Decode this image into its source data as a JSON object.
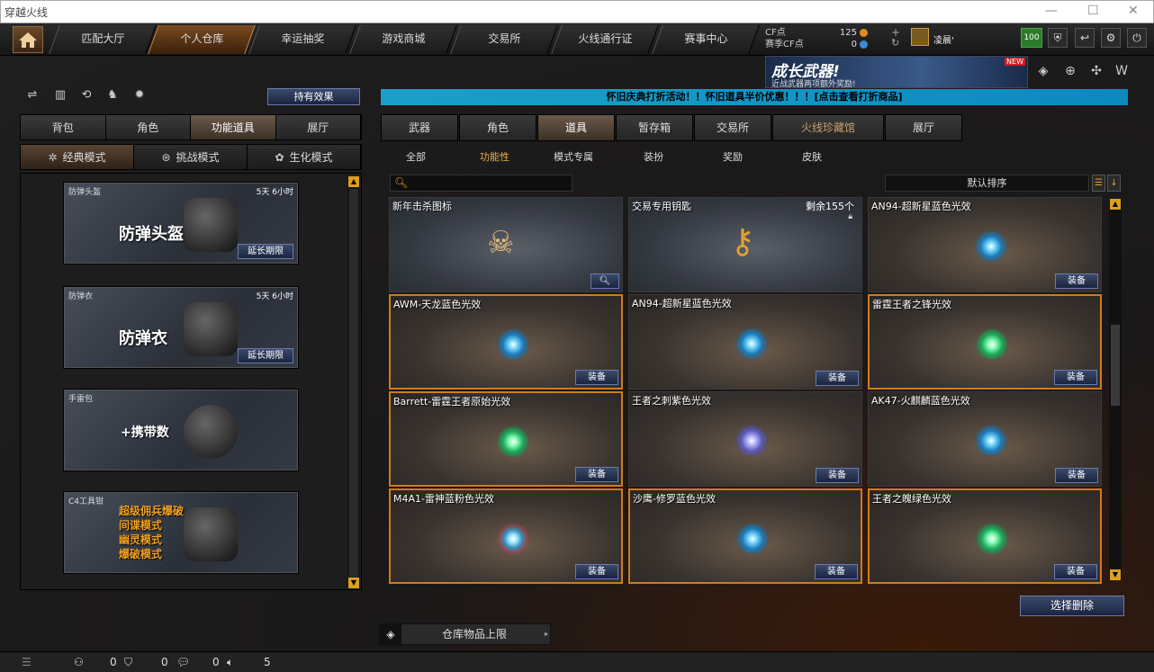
{
  "window": {
    "title": "穿越火线"
  },
  "nav": {
    "tabs": [
      "匹配大厅",
      "个人仓库",
      "幸运抽奖",
      "游戏商城",
      "交易所",
      "火线通行证",
      "赛事中心"
    ],
    "active": 1
  },
  "currency": {
    "cf_label": "CF点",
    "cf_value": "125",
    "match_label": "赛季CF点",
    "match_value": "0"
  },
  "user": {
    "name": "凌晨'",
    "level": "100"
  },
  "promo": {
    "title": "成长武器!",
    "subtitle": "近战武器两项额外奖励!",
    "badge": "NEW"
  },
  "left": {
    "effect_button": "持有效果",
    "tabs": [
      "背包",
      "角色",
      "功能道具",
      "展厅"
    ],
    "active_tab": 2,
    "modes": [
      "经典模式",
      "挑战模式",
      "生化模式"
    ],
    "active_mode": 0,
    "items": [
      {
        "name": "防弹头盔",
        "time": "5天 6小时",
        "big": "防弹头盔",
        "button": "延长期限"
      },
      {
        "name": "防弹衣",
        "time": "5天 6小时",
        "big": "防弹衣",
        "button": "延长期限"
      },
      {
        "name": "手雷包",
        "big": "+携带数"
      },
      {
        "name": "C4工具钳",
        "lines": [
          "超级佣兵爆破",
          "间谍模式",
          "幽灵模式",
          "爆破模式"
        ]
      }
    ]
  },
  "banner": {
    "text": "怀旧庆典打折活动！！怀旧道具半价优惠！！！[点击查看打折商品]"
  },
  "right": {
    "tabs": [
      "武器",
      "角色",
      "道具",
      "暂存箱",
      "交易所",
      "火线珍藏馆",
      "展厅"
    ],
    "active_tab": 2,
    "subcats": [
      "全部",
      "功能性",
      "模式专属",
      "装扮",
      "奖励",
      "皮肤"
    ],
    "active_subcat": 1,
    "search_placeholder": "",
    "sort_label": "默认排序",
    "equip_label": "装备",
    "cards": [
      {
        "name": "新年击杀图标",
        "type": "skull",
        "style": "plain"
      },
      {
        "name": "交易专用钥匙",
        "count": "剩余155个",
        "type": "key",
        "style": "plain"
      },
      {
        "name": "AN94-超新星蓝色光效",
        "orb": "blue",
        "equip": true
      },
      {
        "name": "AWM-天龙蓝色光效",
        "orb": "blue",
        "equip": true,
        "sel": true
      },
      {
        "name": "AN94-超新星蓝色光效",
        "orb": "blue",
        "equip": true
      },
      {
        "name": "雷霆王者之锋光效",
        "orb": "green",
        "equip": true,
        "sel": true
      },
      {
        "name": "Barrett-雷霆王者原始光效",
        "orb": "green",
        "equip": true,
        "sel": true
      },
      {
        "name": "王者之刺紫色光效",
        "orb": "purple",
        "equip": true
      },
      {
        "name": "AK47-火麒麟蓝色光效",
        "orb": "blue",
        "equip": true
      },
      {
        "name": "M4A1-雷神蓝粉色光效",
        "orb": "pink",
        "equip": true,
        "sel": true
      },
      {
        "name": "沙鹰-修罗蓝色光效",
        "orb": "blue",
        "equip": true,
        "sel": true
      },
      {
        "name": "王者之魄绿色光效",
        "orb": "green",
        "equip": true,
        "sel": true
      }
    ],
    "bulk_delete": "选择删除",
    "capacity": "仓库物品上限"
  },
  "status": {
    "a": "0",
    "b": "0",
    "c": "0",
    "d": "5"
  }
}
